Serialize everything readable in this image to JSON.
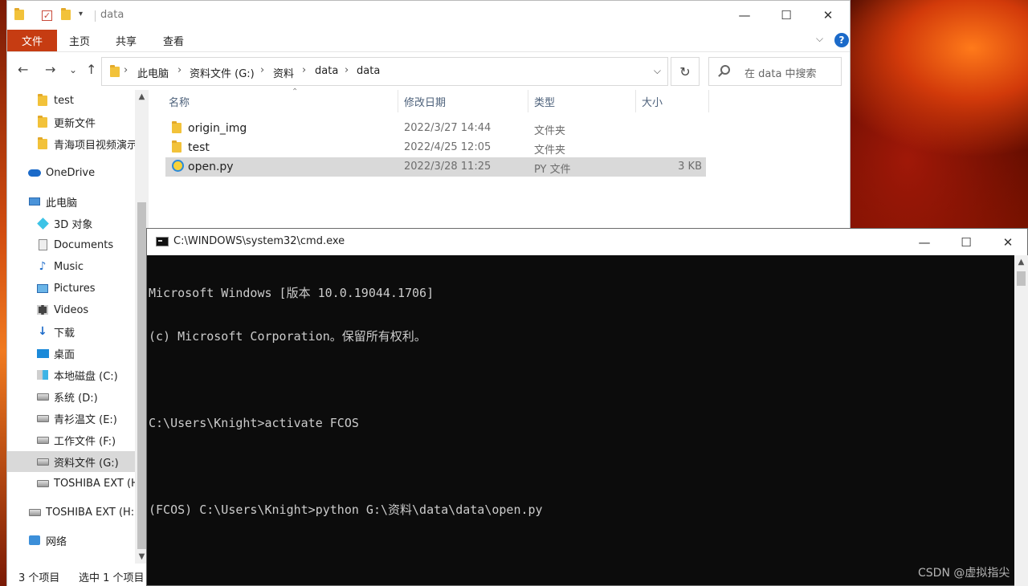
{
  "explorer": {
    "title": "data",
    "ribbon": {
      "file": "文件",
      "tabs": [
        "主页",
        "共享",
        "查看"
      ],
      "expand": "⌵",
      "help": "?"
    },
    "nav": {
      "back": "←",
      "forward": "→",
      "recent": "⌄",
      "up": "↑"
    },
    "address": {
      "crumbs": [
        "此电脑",
        "资料文件 (G:)",
        "资料",
        "data",
        "data"
      ],
      "dropdown": "⌵"
    },
    "refresh": "↻",
    "search_placeholder": "在 data 中搜索",
    "navpane": [
      {
        "label": "test",
        "icon": "folder-icon"
      },
      {
        "label": "更新文件",
        "icon": "folder-icon"
      },
      {
        "label": "青海项目视频演示",
        "icon": "folder-icon"
      },
      {
        "label": "OneDrive",
        "icon": "onedrive-icon"
      },
      {
        "label": "此电脑",
        "icon": "computer-icon"
      },
      {
        "label": "3D 对象",
        "icon": "3d-objects-icon"
      },
      {
        "label": "Documents",
        "icon": "documents-icon"
      },
      {
        "label": "Music",
        "icon": "music-icon"
      },
      {
        "label": "Pictures",
        "icon": "pictures-icon"
      },
      {
        "label": "Videos",
        "icon": "videos-icon"
      },
      {
        "label": "下载",
        "icon": "download-icon"
      },
      {
        "label": "桌面",
        "icon": "desktop-icon"
      },
      {
        "label": "本地磁盘 (C:)",
        "icon": "windows-drive-icon"
      },
      {
        "label": "系统 (D:)",
        "icon": "drive-icon"
      },
      {
        "label": "青衫温文 (E:)",
        "icon": "drive-icon"
      },
      {
        "label": "工作文件 (F:)",
        "icon": "drive-icon"
      },
      {
        "label": "资料文件 (G:)",
        "icon": "drive-icon"
      },
      {
        "label": "TOSHIBA EXT (H:)",
        "icon": "drive-icon"
      },
      {
        "label": "TOSHIBA EXT (H:)",
        "icon": "drive-icon"
      },
      {
        "label": "网络",
        "icon": "network-icon"
      }
    ],
    "columns": [
      "名称",
      "修改日期",
      "类型",
      "大小"
    ],
    "files": [
      {
        "name": "origin_img",
        "date": "2022/3/27 14:44",
        "type": "文件夹",
        "size": "",
        "icon": "folder-icon"
      },
      {
        "name": "test",
        "date": "2022/4/25 12:05",
        "type": "文件夹",
        "size": "",
        "icon": "folder-icon"
      },
      {
        "name": "open.py",
        "date": "2022/3/28 11:25",
        "type": "PY 文件",
        "size": "3 KB",
        "icon": "python-file-icon"
      }
    ],
    "status": {
      "count": "3 个项目",
      "selected": "选中 1 个项目"
    }
  },
  "cmd": {
    "title": "C:\\WINDOWS\\system32\\cmd.exe",
    "lines": [
      "Microsoft Windows [版本 10.0.19044.1706]",
      "(c) Microsoft Corporation。保留所有权利。",
      "",
      "C:\\Users\\Knight>activate FCOS",
      "",
      "(FCOS) C:\\Users\\Knight>python G:\\资料\\data\\data\\open.py"
    ]
  },
  "watermark": "CSDN @虚拟指尖",
  "colors": {
    "ribbon_file": "#c63c12",
    "selection": "#d9d9d9",
    "console_bg": "#0c0c0c",
    "console_text": "#cccccc"
  }
}
